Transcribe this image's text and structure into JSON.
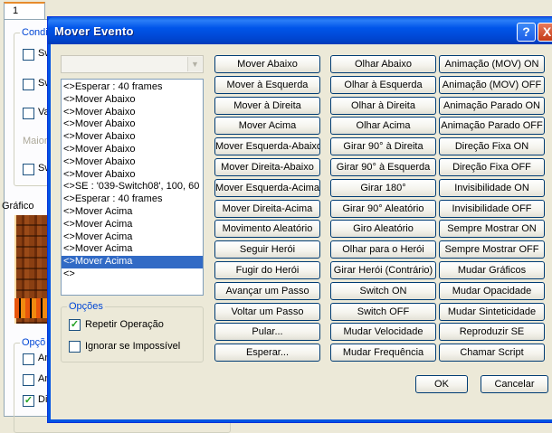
{
  "background": {
    "tab_label": "1",
    "conditions_title": "Condi",
    "cond_checkboxes": [
      "Sw",
      "Sw",
      "Va"
    ],
    "major_label": "Maior",
    "cond_checkbox4": "Sw",
    "graphics_label": "Gráfico",
    "options_title": "Opçõ",
    "opt_checkboxes": [
      "An",
      "An",
      "Di"
    ]
  },
  "dialog": {
    "title": "Mover Evento",
    "help_glyph": "?",
    "close_glyph": "X",
    "combo_value": "",
    "route_list": [
      "<>Esperar : 40 frames",
      "<>Mover Abaixo",
      "<>Mover Abaixo",
      "<>Mover Abaixo",
      "<>Mover Abaixo",
      "<>Mover Abaixo",
      "<>Mover Abaixo",
      "<>Mover Abaixo",
      "<>SE : '039-Switch08', 100, 60",
      "<>Esperar : 40 frames",
      "<>Mover Acima",
      "<>Mover Acima",
      "<>Mover Acima",
      "<>Mover Acima",
      "<>Mover Acima",
      "<>"
    ],
    "selected_index": 14,
    "options": {
      "title": "Opções",
      "repeat_label": "Repetir Operação",
      "ignore_label": "Ignorar se Impossível"
    },
    "col1": [
      "Mover Abaixo",
      "Mover à Esquerda",
      "Mover à Direita",
      "Mover Acima",
      "Mover Esquerda-Abaixo",
      "Mover Direita-Abaixo",
      "Mover Esquerda-Acima",
      "Mover Direita-Acima",
      "Movimento Aleatório",
      "Seguir Herói",
      "Fugir do Herói",
      "Avançar um Passo",
      "Voltar um Passo",
      "Pular...",
      "Esperar..."
    ],
    "col2": [
      "Olhar Abaixo",
      "Olhar à Esquerda",
      "Olhar à Direita",
      "Olhar Acima",
      "Girar 90° à Direita",
      "Girar 90° à Esquerda",
      "Girar 180°",
      "Girar 90° Aleatório",
      "Giro Aleatório",
      "Olhar para o Herói",
      "Girar Herói (Contrário)",
      "Switch ON",
      "Switch OFF",
      "Mudar Velocidade",
      "Mudar Frequência"
    ],
    "col3": [
      "Animação (MOV) ON",
      "Animação (MOV) OFF",
      "Animação Parado ON",
      "Animação Parado OFF",
      "Direção Fixa ON",
      "Direção Fixa OFF",
      "Invisibilidade ON",
      "Invisibilidade OFF",
      "Sempre Mostrar ON",
      "Sempre Mostrar OFF",
      "Mudar Gráficos",
      "Mudar Opacidade",
      "Mudar Sinteticidade",
      "Reproduzir SE",
      "Chamar Script"
    ],
    "ok_label": "OK",
    "cancel_label": "Cancelar"
  }
}
